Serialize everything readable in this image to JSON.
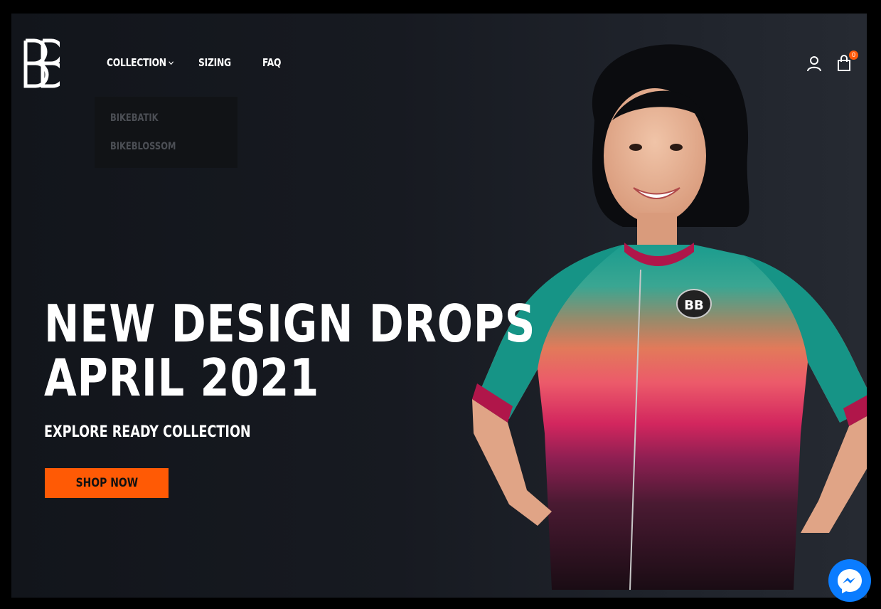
{
  "header": {
    "logo_text": "BB",
    "nav": [
      {
        "label": "COLLECTION"
      },
      {
        "label": "SIZING"
      },
      {
        "label": "FAQ"
      }
    ],
    "dropdown": [
      "BIKEBATIK",
      "BIKEBLOSSOM"
    ],
    "cart_count": "0",
    "icons": [
      "user-icon",
      "shopping-bag-icon",
      "chevron-down-icon"
    ]
  },
  "hero": {
    "headline_line1": "NEW DESIGN DROPS",
    "headline_line2": "APRIL 2021",
    "subheadline": "EXPLORE READY COLLECTION",
    "cta_label": "SHOP NOW",
    "jersey_logo": "BB"
  },
  "colors": {
    "accent": "#ff5a05",
    "background": "#15181e",
    "messenger": "#0a7cff"
  },
  "chat": {
    "icon": "messenger-icon"
  }
}
